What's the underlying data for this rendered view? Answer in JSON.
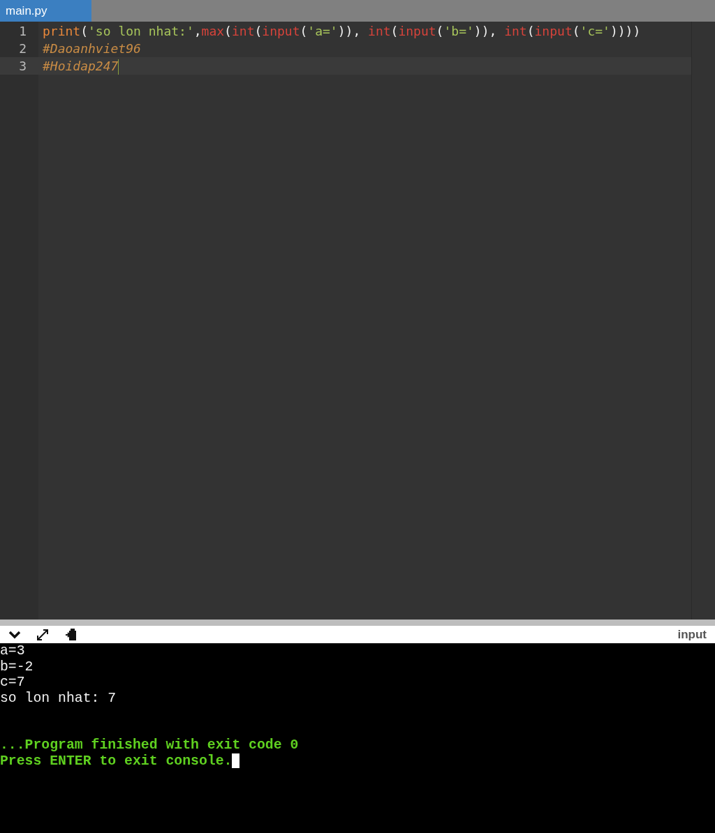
{
  "tabs": [
    {
      "label": "main.py",
      "selected": true
    }
  ],
  "editor": {
    "lines": [
      {
        "number": "1",
        "active": false,
        "tokens": [
          {
            "kind": "builtin",
            "text": "print"
          },
          {
            "kind": "punct",
            "text": "("
          },
          {
            "kind": "string",
            "text": "'so lon nhat:'"
          },
          {
            "kind": "punct",
            "text": ","
          },
          {
            "kind": "function",
            "text": "max"
          },
          {
            "kind": "punct",
            "text": "("
          },
          {
            "kind": "function",
            "text": "int"
          },
          {
            "kind": "punct",
            "text": "("
          },
          {
            "kind": "function",
            "text": "input"
          },
          {
            "kind": "punct",
            "text": "("
          },
          {
            "kind": "string",
            "text": "'a='"
          },
          {
            "kind": "punct",
            "text": ")), "
          },
          {
            "kind": "function",
            "text": "int"
          },
          {
            "kind": "punct",
            "text": "("
          },
          {
            "kind": "function",
            "text": "input"
          },
          {
            "kind": "punct",
            "text": "("
          },
          {
            "kind": "string",
            "text": "'b='"
          },
          {
            "kind": "punct",
            "text": ")), "
          },
          {
            "kind": "function",
            "text": "int"
          },
          {
            "kind": "punct",
            "text": "("
          },
          {
            "kind": "function",
            "text": "input"
          },
          {
            "kind": "punct",
            "text": "("
          },
          {
            "kind": "string",
            "text": "'c='"
          },
          {
            "kind": "punct",
            "text": "))))"
          }
        ]
      },
      {
        "number": "2",
        "active": false,
        "tokens": [
          {
            "kind": "comment",
            "text": "#Daoanhviet96"
          }
        ]
      },
      {
        "number": "3",
        "active": true,
        "tokens": [
          {
            "kind": "comment",
            "text": "#Hoidap247"
          }
        ]
      }
    ]
  },
  "console": {
    "label": "input",
    "lines": [
      {
        "kind": "output",
        "text": "a=3"
      },
      {
        "kind": "output",
        "text": "b=-2"
      },
      {
        "kind": "output",
        "text": "c=7"
      },
      {
        "kind": "output",
        "text": "so lon nhat: 7"
      },
      {
        "kind": "blank"
      },
      {
        "kind": "blank"
      },
      {
        "kind": "status",
        "text": "...Program finished with exit code 0"
      },
      {
        "kind": "status",
        "text": "Press ENTER to exit console.",
        "cursor": true
      }
    ]
  }
}
